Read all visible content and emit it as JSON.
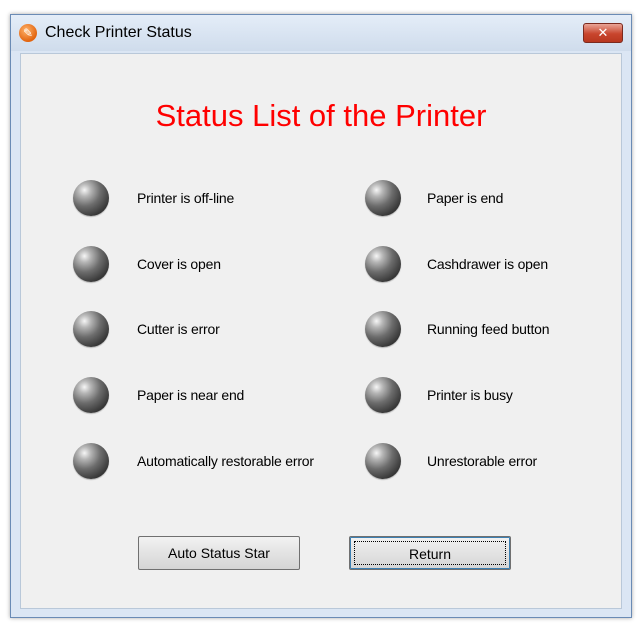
{
  "window": {
    "title": "Check Printer Status",
    "close_label": "✕"
  },
  "heading": "Status List of the Printer",
  "status": {
    "left": [
      "Printer is off-line",
      "Cover is open",
      "Cutter is error",
      "Paper is near end",
      "Automatically restorable error"
    ],
    "right": [
      "Paper is end",
      "Cashdrawer is open",
      "Running feed button",
      "Printer is busy",
      "Unrestorable error"
    ]
  },
  "buttons": {
    "auto_status": "Auto Status Star",
    "return": "Return"
  },
  "colors": {
    "heading": "#ff0000",
    "client_bg": "#f0f0f0",
    "led": "#555555"
  }
}
